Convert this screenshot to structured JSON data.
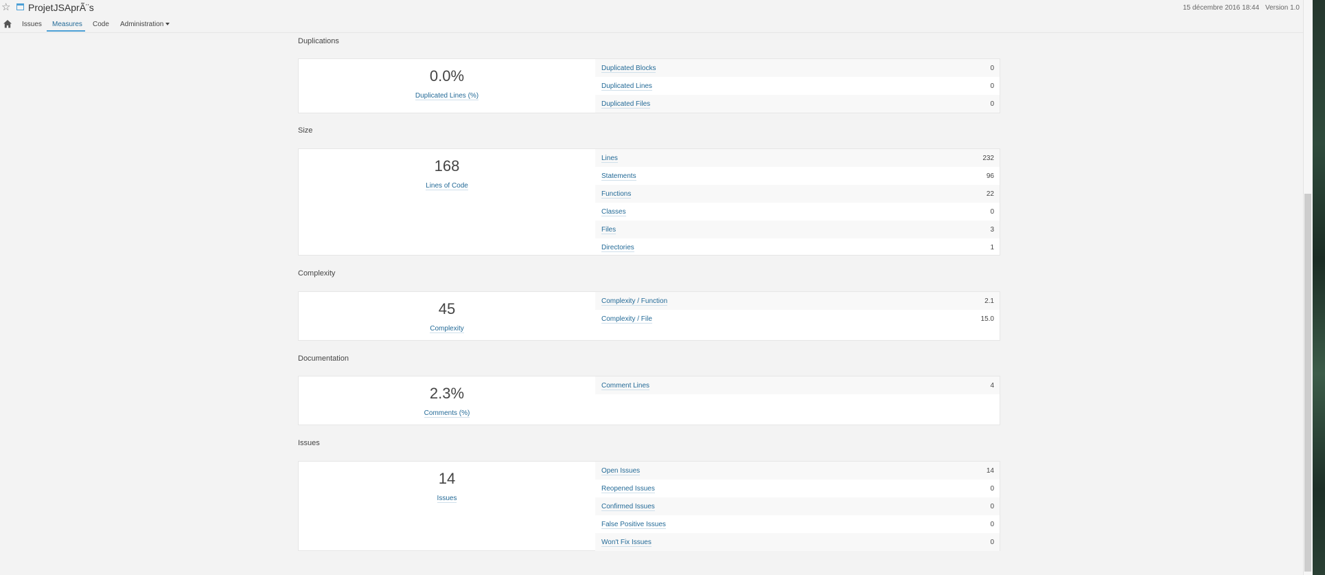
{
  "header": {
    "project_title": "ProjetJSAprÃ¨s",
    "date": "15 décembre 2016 18:44",
    "version": "Version 1.0"
  },
  "nav": {
    "items": [
      {
        "label": "Issues"
      },
      {
        "label": "Measures",
        "active": true
      },
      {
        "label": "Code"
      },
      {
        "label": "Administration"
      }
    ]
  },
  "sections": [
    {
      "title": "Duplications",
      "main_value": "0.0%",
      "main_label": "Duplicated Lines (%)",
      "metrics": [
        {
          "label": "Duplicated Blocks",
          "value": "0"
        },
        {
          "label": "Duplicated Lines",
          "value": "0"
        },
        {
          "label": "Duplicated Files",
          "value": "0"
        }
      ]
    },
    {
      "title": "Size",
      "main_value": "168",
      "main_label": "Lines of Code",
      "metrics": [
        {
          "label": "Lines",
          "value": "232"
        },
        {
          "label": "Statements",
          "value": "96"
        },
        {
          "label": "Functions",
          "value": "22"
        },
        {
          "label": "Classes",
          "value": "0"
        },
        {
          "label": "Files",
          "value": "3"
        },
        {
          "label": "Directories",
          "value": "1"
        }
      ]
    },
    {
      "title": "Complexity",
      "main_value": "45",
      "main_label": "Complexity",
      "metrics": [
        {
          "label": "Complexity / Function",
          "value": "2.1"
        },
        {
          "label": "Complexity / File",
          "value": "15.0"
        }
      ]
    },
    {
      "title": "Documentation",
      "main_value": "2.3%",
      "main_label": "Comments (%)",
      "metrics": [
        {
          "label": "Comment Lines",
          "value": "4"
        }
      ]
    },
    {
      "title": "Issues",
      "main_value": "14",
      "main_label": "Issues",
      "metrics": [
        {
          "label": "Open Issues",
          "value": "14"
        },
        {
          "label": "Reopened Issues",
          "value": "0"
        },
        {
          "label": "Confirmed Issues",
          "value": "0"
        },
        {
          "label": "False Positive Issues",
          "value": "0"
        },
        {
          "label": "Won't Fix Issues",
          "value": "0"
        }
      ]
    }
  ],
  "colors": {
    "link": "#236a97",
    "accent": "#4b9fd5",
    "background": "#f3f3f3"
  },
  "icons": {
    "favorite": "star-icon",
    "project": "project-icon",
    "home": "home-icon"
  }
}
